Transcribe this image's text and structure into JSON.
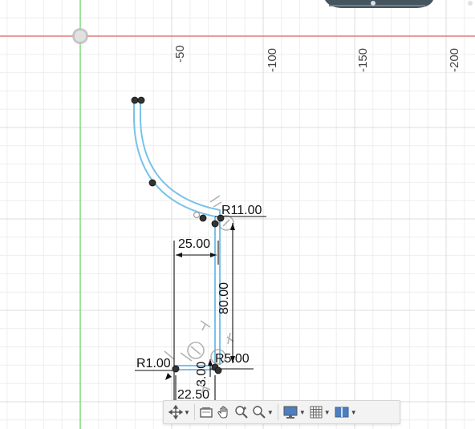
{
  "viewport": {
    "background": "#ffffff",
    "grid_minor_color": "#eeeeee",
    "grid_major_color": "#dcdcdc",
    "x_axis_color": "#e06060",
    "y_axis_color": "#5fd35f",
    "curve_color": "#79c2ea"
  },
  "ruler": {
    "labels": [
      "-50",
      "-100",
      "-150",
      "-200"
    ]
  },
  "dimensions": {
    "r_top": "R11.00",
    "width_top": "25.00",
    "height_main": "80.00",
    "r_left": "R1.00",
    "r_right": "R5.00",
    "small_height": "3.00",
    "width_bottom": "22.50"
  },
  "toolbar": {
    "items": [
      {
        "icon": "orbit-icon",
        "has_menu": true
      },
      {
        "icon": "look-at-icon",
        "has_menu": false
      },
      {
        "icon": "pan-hand-icon",
        "has_menu": false
      },
      {
        "icon": "zoom-icon",
        "has_menu": false
      },
      {
        "icon": "fit-zoom-icon",
        "has_menu": true
      },
      {
        "icon": "display-settings-icon",
        "has_menu": true
      },
      {
        "icon": "grid-settings-icon",
        "has_menu": true
      },
      {
        "icon": "viewports-icon",
        "has_menu": true
      }
    ]
  }
}
